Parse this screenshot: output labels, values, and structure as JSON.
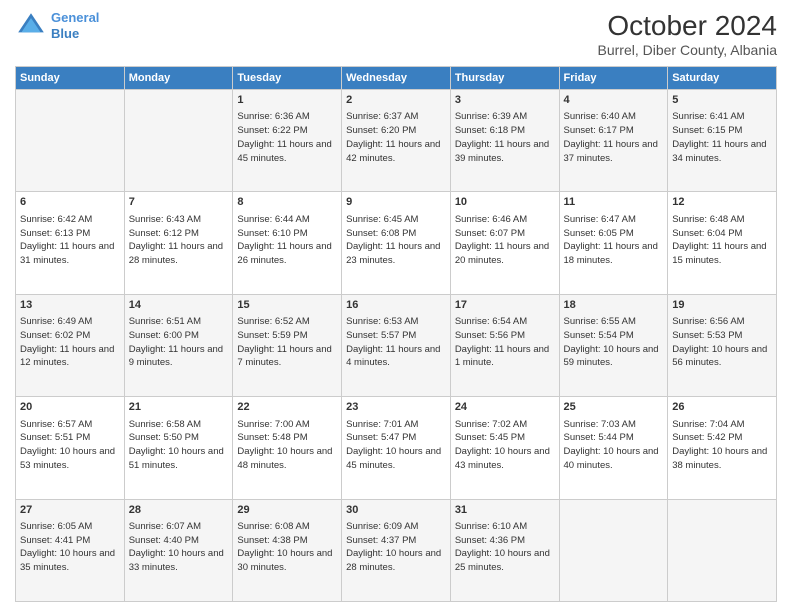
{
  "header": {
    "logo_line1": "General",
    "logo_line2": "Blue",
    "month": "October 2024",
    "location": "Burrel, Diber County, Albania"
  },
  "days_of_week": [
    "Sunday",
    "Monday",
    "Tuesday",
    "Wednesday",
    "Thursday",
    "Friday",
    "Saturday"
  ],
  "weeks": [
    [
      {
        "day": "",
        "info": ""
      },
      {
        "day": "",
        "info": ""
      },
      {
        "day": "1",
        "info": "Sunrise: 6:36 AM\nSunset: 6:22 PM\nDaylight: 11 hours and 45 minutes."
      },
      {
        "day": "2",
        "info": "Sunrise: 6:37 AM\nSunset: 6:20 PM\nDaylight: 11 hours and 42 minutes."
      },
      {
        "day": "3",
        "info": "Sunrise: 6:39 AM\nSunset: 6:18 PM\nDaylight: 11 hours and 39 minutes."
      },
      {
        "day": "4",
        "info": "Sunrise: 6:40 AM\nSunset: 6:17 PM\nDaylight: 11 hours and 37 minutes."
      },
      {
        "day": "5",
        "info": "Sunrise: 6:41 AM\nSunset: 6:15 PM\nDaylight: 11 hours and 34 minutes."
      }
    ],
    [
      {
        "day": "6",
        "info": "Sunrise: 6:42 AM\nSunset: 6:13 PM\nDaylight: 11 hours and 31 minutes."
      },
      {
        "day": "7",
        "info": "Sunrise: 6:43 AM\nSunset: 6:12 PM\nDaylight: 11 hours and 28 minutes."
      },
      {
        "day": "8",
        "info": "Sunrise: 6:44 AM\nSunset: 6:10 PM\nDaylight: 11 hours and 26 minutes."
      },
      {
        "day": "9",
        "info": "Sunrise: 6:45 AM\nSunset: 6:08 PM\nDaylight: 11 hours and 23 minutes."
      },
      {
        "day": "10",
        "info": "Sunrise: 6:46 AM\nSunset: 6:07 PM\nDaylight: 11 hours and 20 minutes."
      },
      {
        "day": "11",
        "info": "Sunrise: 6:47 AM\nSunset: 6:05 PM\nDaylight: 11 hours and 18 minutes."
      },
      {
        "day": "12",
        "info": "Sunrise: 6:48 AM\nSunset: 6:04 PM\nDaylight: 11 hours and 15 minutes."
      }
    ],
    [
      {
        "day": "13",
        "info": "Sunrise: 6:49 AM\nSunset: 6:02 PM\nDaylight: 11 hours and 12 minutes."
      },
      {
        "day": "14",
        "info": "Sunrise: 6:51 AM\nSunset: 6:00 PM\nDaylight: 11 hours and 9 minutes."
      },
      {
        "day": "15",
        "info": "Sunrise: 6:52 AM\nSunset: 5:59 PM\nDaylight: 11 hours and 7 minutes."
      },
      {
        "day": "16",
        "info": "Sunrise: 6:53 AM\nSunset: 5:57 PM\nDaylight: 11 hours and 4 minutes."
      },
      {
        "day": "17",
        "info": "Sunrise: 6:54 AM\nSunset: 5:56 PM\nDaylight: 11 hours and 1 minute."
      },
      {
        "day": "18",
        "info": "Sunrise: 6:55 AM\nSunset: 5:54 PM\nDaylight: 10 hours and 59 minutes."
      },
      {
        "day": "19",
        "info": "Sunrise: 6:56 AM\nSunset: 5:53 PM\nDaylight: 10 hours and 56 minutes."
      }
    ],
    [
      {
        "day": "20",
        "info": "Sunrise: 6:57 AM\nSunset: 5:51 PM\nDaylight: 10 hours and 53 minutes."
      },
      {
        "day": "21",
        "info": "Sunrise: 6:58 AM\nSunset: 5:50 PM\nDaylight: 10 hours and 51 minutes."
      },
      {
        "day": "22",
        "info": "Sunrise: 7:00 AM\nSunset: 5:48 PM\nDaylight: 10 hours and 48 minutes."
      },
      {
        "day": "23",
        "info": "Sunrise: 7:01 AM\nSunset: 5:47 PM\nDaylight: 10 hours and 45 minutes."
      },
      {
        "day": "24",
        "info": "Sunrise: 7:02 AM\nSunset: 5:45 PM\nDaylight: 10 hours and 43 minutes."
      },
      {
        "day": "25",
        "info": "Sunrise: 7:03 AM\nSunset: 5:44 PM\nDaylight: 10 hours and 40 minutes."
      },
      {
        "day": "26",
        "info": "Sunrise: 7:04 AM\nSunset: 5:42 PM\nDaylight: 10 hours and 38 minutes."
      }
    ],
    [
      {
        "day": "27",
        "info": "Sunrise: 6:05 AM\nSunset: 4:41 PM\nDaylight: 10 hours and 35 minutes."
      },
      {
        "day": "28",
        "info": "Sunrise: 6:07 AM\nSunset: 4:40 PM\nDaylight: 10 hours and 33 minutes."
      },
      {
        "day": "29",
        "info": "Sunrise: 6:08 AM\nSunset: 4:38 PM\nDaylight: 10 hours and 30 minutes."
      },
      {
        "day": "30",
        "info": "Sunrise: 6:09 AM\nSunset: 4:37 PM\nDaylight: 10 hours and 28 minutes."
      },
      {
        "day": "31",
        "info": "Sunrise: 6:10 AM\nSunset: 4:36 PM\nDaylight: 10 hours and 25 minutes."
      },
      {
        "day": "",
        "info": ""
      },
      {
        "day": "",
        "info": ""
      }
    ]
  ]
}
